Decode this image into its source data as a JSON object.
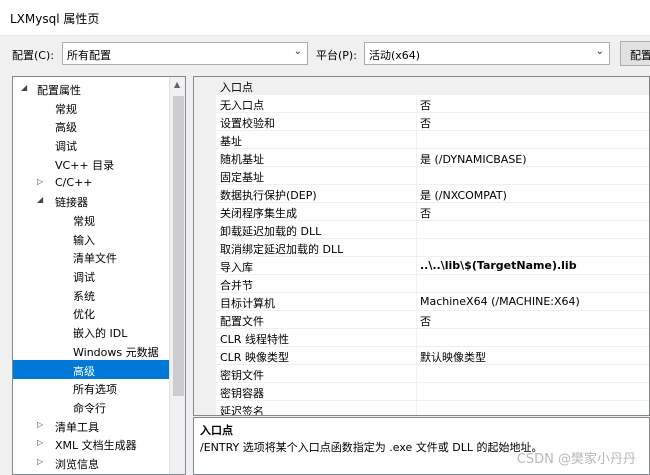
{
  "window": {
    "title": "LXMysql 属性页"
  },
  "config": {
    "config_label": "配置(C):",
    "config_value": "所有配置",
    "platform_label": "平台(P):",
    "platform_value": "活动(x64)",
    "manager_button": "配置"
  },
  "tree": {
    "items": [
      {
        "label": "配置属性",
        "arrow": "◢"
      },
      {
        "label": "常规"
      },
      {
        "label": "高级"
      },
      {
        "label": "调试"
      },
      {
        "label": "VC++ 目录"
      },
      {
        "label": "C/C++",
        "arrow": "▷"
      },
      {
        "label": "链接器",
        "arrow": "◢"
      },
      {
        "label": "常规"
      },
      {
        "label": "输入"
      },
      {
        "label": "清单文件"
      },
      {
        "label": "调试"
      },
      {
        "label": "系统"
      },
      {
        "label": "优化"
      },
      {
        "label": "嵌入的 IDL"
      },
      {
        "label": "Windows 元数据"
      },
      {
        "label": "高级"
      },
      {
        "label": "所有选项"
      },
      {
        "label": "命令行"
      },
      {
        "label": "清单工具",
        "arrow": "▷"
      },
      {
        "label": "XML 文档生成器",
        "arrow": "▷"
      },
      {
        "label": "浏览信息",
        "arrow": "▷"
      }
    ]
  },
  "grid": {
    "rows": [
      {
        "name": "入口点",
        "value": ""
      },
      {
        "name": "无入口点",
        "value": "否"
      },
      {
        "name": "设置校验和",
        "value": "否"
      },
      {
        "name": "基址",
        "value": ""
      },
      {
        "name": "随机基址",
        "value": "是 (/DYNAMICBASE)"
      },
      {
        "name": "固定基址",
        "value": ""
      },
      {
        "name": "数据执行保护(DEP)",
        "value": "是 (/NXCOMPAT)"
      },
      {
        "name": "关闭程序集生成",
        "value": "否"
      },
      {
        "name": "卸载延迟加载的 DLL",
        "value": ""
      },
      {
        "name": "取消绑定延迟加载的 DLL",
        "value": ""
      },
      {
        "name": "导入库",
        "value": "..\\..\\lib\\$(TargetName).lib"
      },
      {
        "name": "合并节",
        "value": ""
      },
      {
        "name": "目标计算机",
        "value": "MachineX64 (/MACHINE:X64)"
      },
      {
        "name": "配置文件",
        "value": "否"
      },
      {
        "name": "CLR 线程特性",
        "value": ""
      },
      {
        "name": "CLR 映像类型",
        "value": "默认映像类型"
      },
      {
        "name": "密钥文件",
        "value": ""
      },
      {
        "name": "密钥容器",
        "value": ""
      },
      {
        "name": "延迟签名",
        "value": ""
      }
    ]
  },
  "description": {
    "title": "入口点",
    "text": "/ENTRY 选项将某个入口点函数指定为 .exe 文件或 DLL 的起始地址。"
  },
  "watermark": "CSDN @樊家小丹丹"
}
